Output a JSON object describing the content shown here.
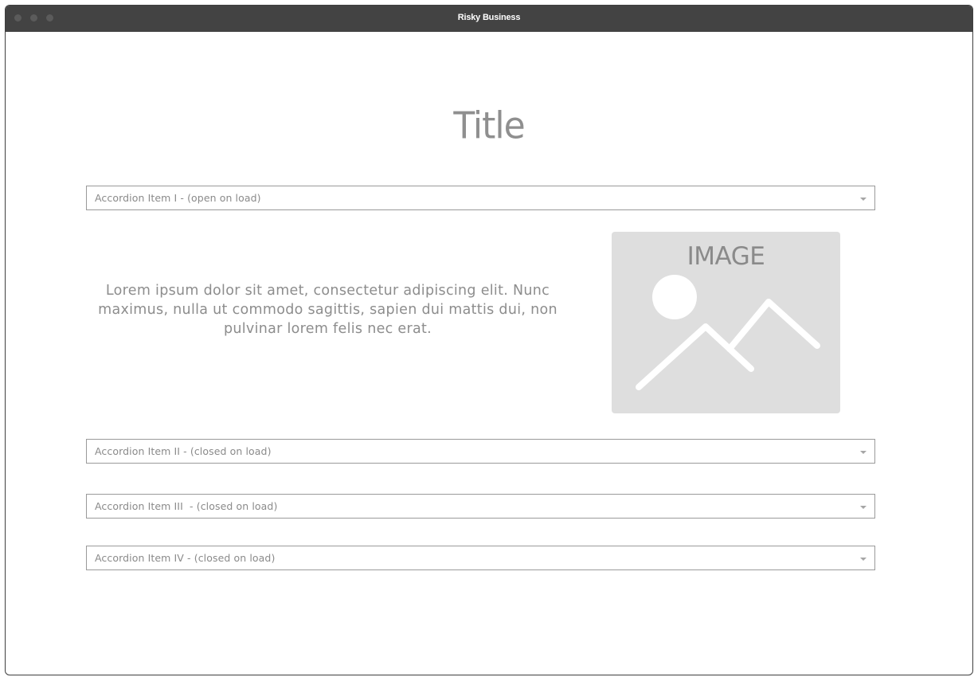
{
  "window": {
    "title": "Risky Business"
  },
  "page": {
    "title": "Title"
  },
  "accordion": {
    "items": [
      {
        "label": "Accordion Item I - (open on load)"
      },
      {
        "label": "Accordion Item II - (closed on load)"
      },
      {
        "label": "Accordion Item III  - (closed on load)"
      },
      {
        "label": "Accordion Item IV - (closed on load)"
      }
    ],
    "open_panel": {
      "text": "Lorem ipsum dolor sit amet, consectetur adipiscing elit. Nunc maximus, nulla ut commodo sagittis, sapien dui mattis dui, non pulvinar lorem felis nec erat.",
      "image_label": "IMAGE"
    }
  },
  "icons": {
    "caret": "chevron-down-icon",
    "image_placeholder": "image-icon"
  },
  "colors": {
    "titlebar": "#434343",
    "text": "#8a8a8a",
    "border": "#9a9a9a",
    "image_bg": "#dedede"
  }
}
